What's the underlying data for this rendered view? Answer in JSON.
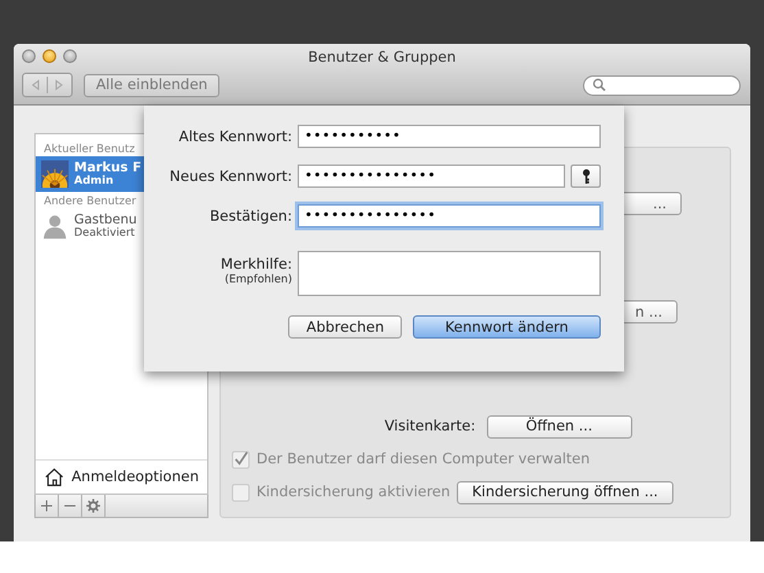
{
  "window": {
    "title": "Benutzer & Gruppen"
  },
  "toolbar": {
    "show_all_button": "Alle einblenden"
  },
  "sidebar": {
    "sections": [
      {
        "header": "Aktueller Benutz",
        "users": [
          {
            "name": "Markus F",
            "role": "Admin",
            "selected": true
          }
        ]
      },
      {
        "header": "Andere Benutzer",
        "users": [
          {
            "name": "Gastbenu",
            "role": "Deaktiviert",
            "selected": false
          }
        ]
      }
    ],
    "login_options": "Anmeldeoptionen"
  },
  "panel": {
    "covered_buttons": [
      "...",
      "n ..."
    ],
    "card_label": "Visitenkarte:",
    "card_button": "Öffnen ...",
    "checkboxes": [
      {
        "label": "Der Benutzer darf diesen Computer verwalten",
        "checked": true,
        "disabled": true
      },
      {
        "label": "Kindersicherung aktivieren",
        "checked": false,
        "disabled": true,
        "button": "Kindersicherung öffnen ..."
      }
    ]
  },
  "sheet": {
    "fields": [
      {
        "kind": "password",
        "label": "Altes Kennwort:",
        "value": "•••••••••••",
        "focused": false
      },
      {
        "kind": "password_assistant",
        "label": "Neues Kennwort:",
        "value": "•••••••••••••••",
        "focused": false
      },
      {
        "kind": "password",
        "label": "Bestätigen:",
        "value": "•••••••••••••••",
        "focused": true
      },
      {
        "kind": "hint",
        "label": "Merkhilfe:",
        "sublabel": "(Empfohlen)",
        "focused": false
      }
    ],
    "buttons": [
      {
        "label": "Abbrechen",
        "default": false
      },
      {
        "label": "Kennwort ändern",
        "default": true
      }
    ]
  }
}
